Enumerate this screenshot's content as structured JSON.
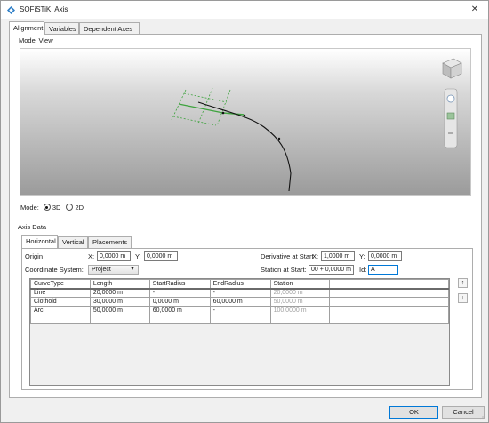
{
  "window": {
    "title": "SOFiSTiK: Axis"
  },
  "main_tabs": [
    {
      "label": "Alignment",
      "active": true
    },
    {
      "label": "Variables",
      "active": false
    },
    {
      "label": "Dependent Axes",
      "active": false
    }
  ],
  "model_view": {
    "group_label": "Model View",
    "mode_label": "Mode:",
    "mode_options": [
      {
        "label": "3D",
        "selected": true
      },
      {
        "label": "2D",
        "selected": false
      }
    ]
  },
  "axis_data": {
    "group_label": "Axis Data",
    "tabs": [
      {
        "label": "Horizontal",
        "active": true
      },
      {
        "label": "Vertical",
        "active": false
      },
      {
        "label": "Placements",
        "active": false
      }
    ],
    "origin": {
      "label": "Origin",
      "x_label": "X:",
      "x_value": "0,0000 m",
      "y_label": "Y:",
      "y_value": "0,0000 m"
    },
    "derivative": {
      "label": "Derivative at Start",
      "x_label": "X:",
      "x_value": "1,0000 m",
      "y_label": "Y:",
      "y_value": "0,0000 m"
    },
    "coordinate_system": {
      "label": "Coordinate System:",
      "value": "Project"
    },
    "station_start": {
      "label": "Station at Start:",
      "value": "00 + 0,0000 m",
      "id_label": "Id:",
      "id_value": "A"
    },
    "table": {
      "columns": [
        "CurveType",
        "Length",
        "StartRadius",
        "EndRadius",
        "Station"
      ],
      "rows": [
        [
          "Line",
          "20,0000 m",
          "-",
          "-",
          "20,0000 m"
        ],
        [
          "Clothoid",
          "30,0000 m",
          "0,0000 m",
          "60,0000 m",
          "50,0000 m"
        ],
        [
          "Arc",
          "50,0000 m",
          "60,0000 m",
          "-",
          "100,0000 m"
        ],
        [
          "",
          "",
          "",
          "",
          ""
        ]
      ]
    },
    "move_up": "↑",
    "move_down": "↓"
  },
  "buttons": {
    "ok": "OK",
    "cancel": "Cancel"
  },
  "colors": {
    "accent": "#0078d7",
    "axis_green": "#3ea33e"
  }
}
